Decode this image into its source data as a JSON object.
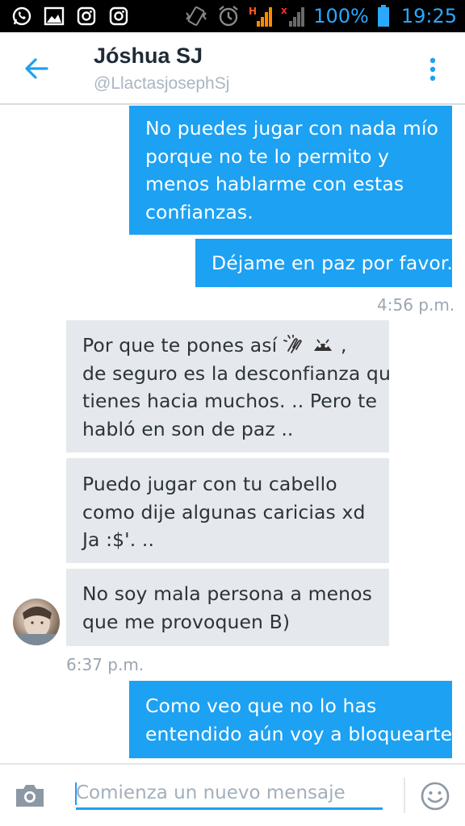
{
  "status_bar": {
    "battery": "100%",
    "time": "19:25"
  },
  "header": {
    "name": "Jóshua SJ",
    "handle": "@LlactasjosephSj"
  },
  "messages": {
    "m1": [
      "No puedes jugar con nada mío",
      "porque no te lo permito y",
      "menos hablarme con estas",
      "confianzas."
    ],
    "m2": [
      "Déjame en paz por favor."
    ],
    "ts1": "4:56 p.m.",
    "m3": [
      "Por que te pones así",
      ",",
      "de seguro es la desconfianza qu",
      "tienes hacia muchos. .. Pero te",
      "habló en son de paz .."
    ],
    "m4": [
      "Puedo jugar con tu cabello",
      "como dije algunas caricias xd",
      "Ja :$'. .."
    ],
    "m5": [
      "No soy mala persona a menos",
      "que me provoquen B)"
    ],
    "ts2": "6:37 p.m.",
    "m6": [
      "Como veo que no lo has",
      "entendido aún voy a bloquearte."
    ]
  },
  "compose": {
    "placeholder": "Comienza un nuevo mensaje"
  },
  "icons": {
    "status_left": [
      "whatsapp-icon",
      "gallery-icon",
      "instagram-icon",
      "instagram-icon"
    ],
    "status_right": [
      "vibrate-icon",
      "alarm-icon",
      "signal-h-icon",
      "signal-x-icon",
      "battery-icon"
    ],
    "header": [
      "back-arrow-icon",
      "overflow-menu-icon"
    ],
    "compose": [
      "camera-icon",
      "emoji-icon"
    ]
  },
  "colors": {
    "accent": "#1da1f2",
    "sent_bubble": "#1da1f2",
    "received_bubble": "#e5e9ed",
    "status_text": "#2aa8ff"
  }
}
